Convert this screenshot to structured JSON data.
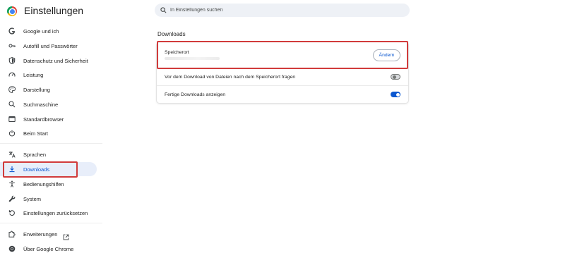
{
  "header": {
    "title": "Einstellungen",
    "logo_icon": "chrome-logo-icon"
  },
  "search": {
    "placeholder": "In Einstellungen suchen",
    "value": ""
  },
  "sidebar": {
    "items": [
      {
        "label": "Google und ich",
        "icon": "google-g-icon"
      },
      {
        "label": "Autofill und Passwörter",
        "icon": "key-icon"
      },
      {
        "label": "Datenschutz und Sicherheit",
        "icon": "shield-icon"
      },
      {
        "label": "Leistung",
        "icon": "speedometer-icon"
      },
      {
        "label": "Darstellung",
        "icon": "palette-icon"
      },
      {
        "label": "Suchmaschine",
        "icon": "search-icon"
      },
      {
        "label": "Standardbrowser",
        "icon": "browser-window-icon"
      },
      {
        "label": "Beim Start",
        "icon": "power-icon"
      },
      {
        "label": "Sprachen",
        "icon": "translate-icon"
      },
      {
        "label": "Downloads",
        "icon": "download-icon",
        "active": true
      },
      {
        "label": "Bedienungshilfen",
        "icon": "accessibility-icon"
      },
      {
        "label": "System",
        "icon": "wrench-icon"
      },
      {
        "label": "Einstellungen zurücksetzen",
        "icon": "reset-icon"
      },
      {
        "label": "Erweiterungen",
        "icon": "puzzle-icon"
      },
      {
        "label": "Über Google Chrome",
        "icon": "chrome-logo-icon"
      }
    ]
  },
  "downloads": {
    "section_title": "Downloads",
    "location_label": "Speicherort",
    "change_button": "Ändern",
    "ask_label": "Vor dem Download von Dateien nach dem Speicherort fragen",
    "ask_enabled": false,
    "show_label": "Fertige Downloads anzeigen",
    "show_enabled": true
  },
  "colors": {
    "accent": "#0b57d0",
    "highlight_box": "#d13b3b",
    "active_nav_bg": "#e8eefa"
  }
}
